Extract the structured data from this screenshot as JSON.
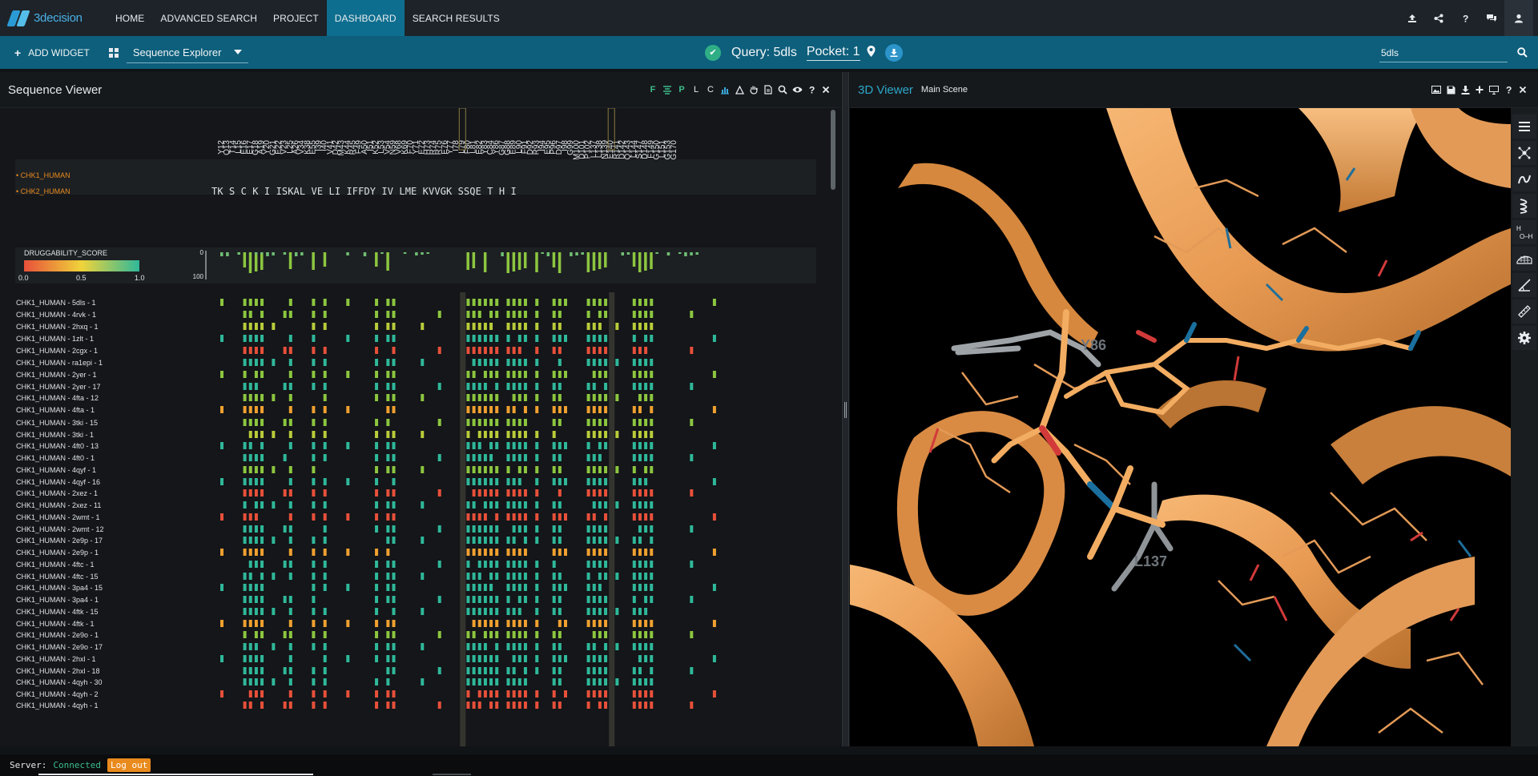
{
  "app": {
    "logo_text": "3decision",
    "nav": [
      "HOME",
      "ADVANCED SEARCH",
      "PROJECT",
      "DASHBOARD",
      "SEARCH RESULTS"
    ],
    "active_nav": "DASHBOARD"
  },
  "toolbar": {
    "add_widget_label": "ADD WIDGET",
    "layout_selected": "Sequence Explorer",
    "query_label": "Query: 5dls",
    "pocket_label": "Pocket: 1",
    "search_value": "5dls"
  },
  "sequence_viewer": {
    "title": "Sequence Viewer",
    "tool_letters": [
      "F",
      "P",
      "L",
      "C"
    ],
    "residues": [
      "Y12",
      "Q13",
      "T14",
      "L15",
      "E16",
      "E17",
      "G18",
      "A19",
      "Y20",
      "G21",
      "E22",
      "V23",
      "L25",
      "A26",
      "V34",
      "K38",
      "E55",
      "I39",
      "I40",
      "V41",
      "D42",
      "M43",
      "K44",
      "R45",
      "F49",
      "A50",
      "I51",
      "K52",
      "L53",
      "V54",
      "N59",
      "V68",
      "K69",
      "F70",
      "Y71",
      "E72",
      "H73",
      "R74",
      "R75",
      "E76",
      "Y77",
      "I78",
      "L79",
      "F80",
      "L81",
      "E82",
      "Y83",
      "C84",
      "Y86",
      "G87",
      "G88",
      "E89",
      "L90",
      "F91",
      "D92",
      "R93",
      "I94",
      "E95",
      "P96",
      "D97",
      "I98",
      "G99",
      "M100",
      "D101",
      "P102",
      "L137",
      "L138",
      "N139",
      "E140",
      "R141",
      "D142",
      "Q143",
      "L144",
      "S147",
      "D148",
      "F149",
      "G150",
      "L151",
      "G153",
      "G170"
    ],
    "consensus_rows": [
      {
        "label": "CHK1_HUMAN"
      },
      {
        "label": "CHK2_HUMAN"
      }
    ],
    "consensus_text": "TK  S  C    K  I  ISKAL  VE  LI  IFFDY  IV  LME    KVVGK     SSQE  T   H  I",
    "druggability": {
      "label": "DRUGGABILITY_SCORE",
      "min": "0.0",
      "mid": "0.5",
      "max": "1.0",
      "axis_top": "0",
      "axis_bottom": "100"
    },
    "rows": [
      "CHK1_HUMAN - 5dls - 1",
      "CHK1_HUMAN - 4rvk - 1",
      "CHK1_HUMAN - 2hxq - 1",
      "CHK1_HUMAN - 1zlt - 1",
      "CHK1_HUMAN - 2cgx - 1",
      "CHK1_HUMAN - ra1epi - 1",
      "CHK1_HUMAN - 2yer - 1",
      "CHK1_HUMAN - 2yer - 17",
      "CHK1_HUMAN - 4fta - 12",
      "CHK1_HUMAN - 4fta - 1",
      "CHK1_HUMAN - 3tki - 15",
      "CHK1_HUMAN - 3tki - 1",
      "CHK1_HUMAN - 4ft0 - 13",
      "CHK1_HUMAN - 4ft0 - 1",
      "CHK1_HUMAN - 4qyf - 1",
      "CHK1_HUMAN - 4qyf - 16",
      "CHK1_HUMAN - 2xez - 1",
      "CHK1_HUMAN - 2xez - 11",
      "CHK1_HUMAN - 2wmt - 1",
      "CHK1_HUMAN - 2wmt - 12",
      "CHK1_HUMAN - 2e9p - 17",
      "CHK1_HUMAN - 2e9p - 1",
      "CHK1_HUMAN - 4ftc - 1",
      "CHK1_HUMAN - 4ftc - 15",
      "CHK1_HUMAN - 3pa4 - 15",
      "CHK1_HUMAN - 3pa4 - 1",
      "CHK1_HUMAN - 4ftk - 15",
      "CHK1_HUMAN - 4ftk - 1",
      "CHK1_HUMAN - 2e9o - 1",
      "CHK1_HUMAN - 2e9o - 17",
      "CHK1_HUMAN - 2hxl - 1",
      "CHK1_HUMAN - 2hxl - 18",
      "CHK1_HUMAN - 4qyh - 30",
      "CHK1_HUMAN - 4qyh - 2",
      "CHK1_HUMAN - 4qyh - 1"
    ]
  },
  "viewer3d": {
    "title": "3D Viewer",
    "scene_label": "Main Scene",
    "residue_labels": [
      "Y86",
      "L137"
    ]
  },
  "status": {
    "server_label": "Server:",
    "server_value": "Connected",
    "logout_label": "Log out"
  },
  "colors": {
    "accent": "#0d5f7c",
    "active_nav": "#0e6e8f",
    "ribbon": "#f0a55a",
    "green": "#3bbd8b",
    "orange": "#e98a1c",
    "red": "#e8503a"
  }
}
